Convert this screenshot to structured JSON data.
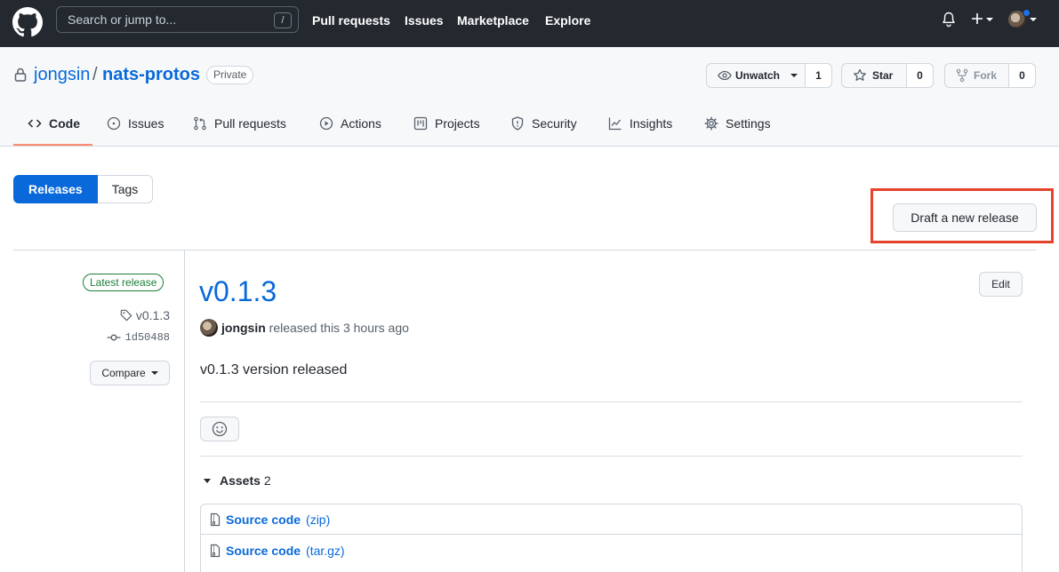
{
  "header": {
    "search_placeholder": "Search or jump to...",
    "search_shortcut": "/",
    "nav": [
      "Pull requests",
      "Issues",
      "Marketplace",
      "Explore"
    ]
  },
  "repo": {
    "owner": "jongsin",
    "separator": "/",
    "name": "nats-protos",
    "visibility": "Private",
    "watch_label": "Unwatch",
    "watch_count": "1",
    "star_label": "Star",
    "star_count": "0",
    "fork_label": "Fork",
    "fork_count": "0"
  },
  "tabs": [
    {
      "label": "Code",
      "icon": "code-icon",
      "active": true
    },
    {
      "label": "Issues",
      "icon": "issue-icon"
    },
    {
      "label": "Pull requests",
      "icon": "pull-request-icon"
    },
    {
      "label": "Actions",
      "icon": "play-icon"
    },
    {
      "label": "Projects",
      "icon": "project-icon"
    },
    {
      "label": "Security",
      "icon": "shield-icon"
    },
    {
      "label": "Insights",
      "icon": "graph-icon"
    },
    {
      "label": "Settings",
      "icon": "gear-icon"
    }
  ],
  "releases_page": {
    "subnav": [
      "Releases",
      "Tags"
    ],
    "draft_button": "Draft a new release"
  },
  "release": {
    "badge": "Latest release",
    "tag": "v0.1.3",
    "commit": "1d50488",
    "compare_label": "Compare",
    "title": "v0.1.3",
    "edit_label": "Edit",
    "author": "jongsin",
    "released_text": "released this 3 hours ago",
    "body": "v0.1.3 version released",
    "assets_label": "Assets",
    "assets_count": "2",
    "assets": [
      {
        "name": "Source code",
        "ext": "(zip)"
      },
      {
        "name": "Source code",
        "ext": "(tar.gz)"
      }
    ]
  },
  "colors": {
    "header_bg": "#24292f",
    "link": "#0969da",
    "primary_button": "#0969da",
    "latest_badge": "#1a7f37",
    "highlight_box": "#e5432b",
    "tab_underline": "#fd8c73"
  }
}
